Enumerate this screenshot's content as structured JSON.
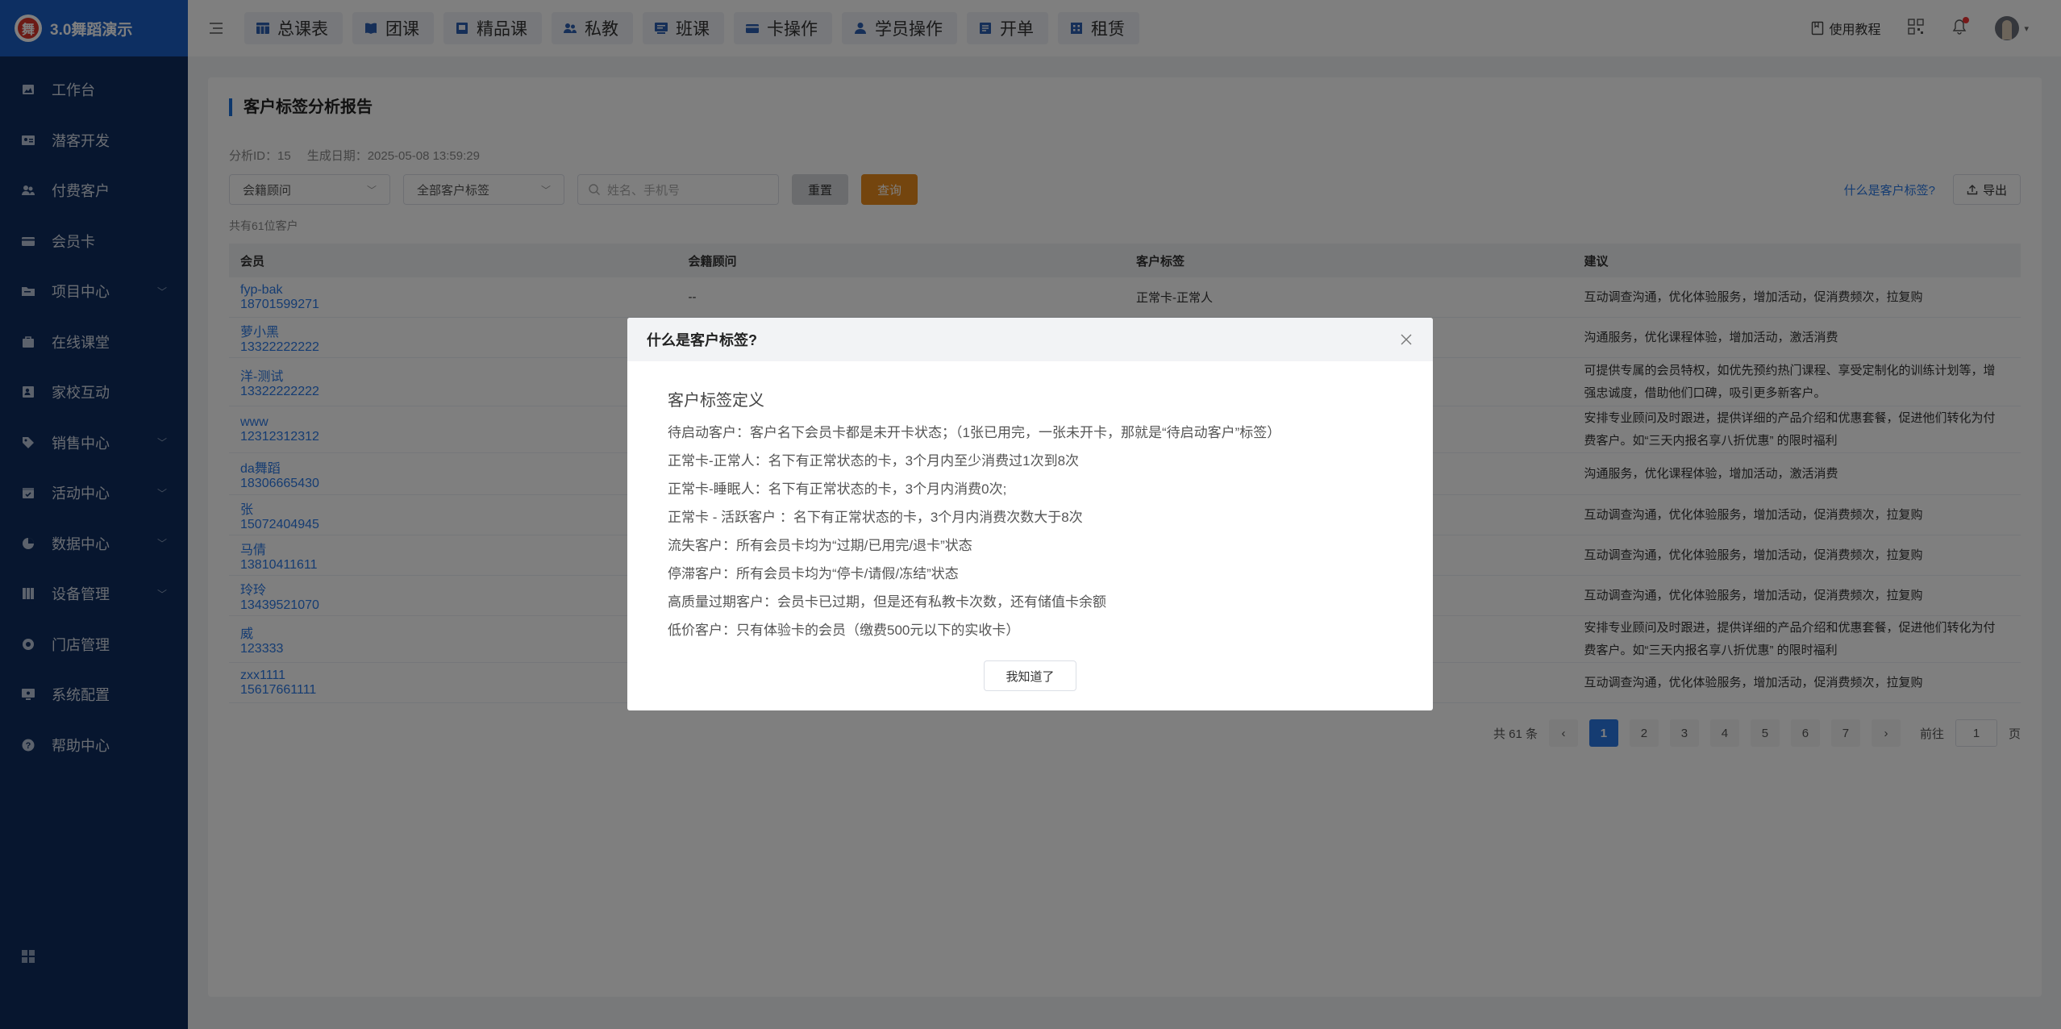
{
  "app": {
    "title": "3.0舞蹈演示",
    "logo_char": "舞"
  },
  "sidebar": {
    "items": [
      {
        "label": "工作台",
        "icon": "image-icon",
        "chevron": false
      },
      {
        "label": "潜客开发",
        "icon": "id-card-icon",
        "chevron": false
      },
      {
        "label": "付费客户",
        "icon": "users-icon",
        "chevron": false
      },
      {
        "label": "会员卡",
        "icon": "card-icon",
        "chevron": false
      },
      {
        "label": "项目中心",
        "icon": "folder-icon",
        "chevron": true
      },
      {
        "label": "在线课堂",
        "icon": "bag-icon",
        "chevron": false
      },
      {
        "label": "家校互动",
        "icon": "contact-icon",
        "chevron": false
      },
      {
        "label": "销售中心",
        "icon": "tag-icon",
        "chevron": true
      },
      {
        "label": "活动中心",
        "icon": "calendar-icon",
        "chevron": true
      },
      {
        "label": "数据中心",
        "icon": "pie-icon",
        "chevron": true
      },
      {
        "label": "设备管理",
        "icon": "device-icon",
        "chevron": true
      },
      {
        "label": "门店管理",
        "icon": "store-icon",
        "chevron": false
      },
      {
        "label": "系统配置",
        "icon": "monitor-icon",
        "chevron": false
      },
      {
        "label": "帮助中心",
        "icon": "help-icon",
        "chevron": false
      }
    ]
  },
  "topnav": {
    "tabs": [
      {
        "label": "总课表",
        "icon": "table-icon"
      },
      {
        "label": "团课",
        "icon": "book-icon"
      },
      {
        "label": "精品课",
        "icon": "premium-icon"
      },
      {
        "label": "私教",
        "icon": "users-icon"
      },
      {
        "label": "班课",
        "icon": "class-icon"
      },
      {
        "label": "卡操作",
        "icon": "card-icon"
      },
      {
        "label": "学员操作",
        "icon": "user-icon"
      },
      {
        "label": "开单",
        "icon": "order-icon"
      },
      {
        "label": "租赁",
        "icon": "building-icon"
      }
    ],
    "tutorial": "使用教程"
  },
  "page": {
    "title": "客户标签分析报告",
    "analysis_id": "分析ID：15",
    "generated": "生成日期：2025-05-08 13:59:29",
    "filter_advisor": "会籍顾问",
    "filter_tags": "全部客户标签",
    "search_placeholder": "姓名、手机号",
    "reset": "重置",
    "query": "查询",
    "what_is_link": "什么是客户标签?",
    "export": "导出",
    "count": "共有61位客户"
  },
  "table": {
    "headers": [
      "会员",
      "会籍顾问",
      "客户标签",
      "建议"
    ],
    "rows": [
      {
        "name": "fyp-bak",
        "phone": "18701599271",
        "advisor": "--",
        "tag": "正常卡-正常人",
        "advice": "互动调查沟通，优化体验服务，增加活动，促消费频次，拉复购",
        "h": 50
      },
      {
        "name": "萝小黑",
        "phone": "13322222222",
        "advisor": "",
        "tag": "",
        "advice": "沟通服务，优化课程体验，增加活动，激活消费",
        "h": 50
      },
      {
        "name": "洋-测试",
        "phone": "13322222222",
        "advisor": "",
        "tag": "",
        "advice": "可提供专属的会员特权，如优先预约热门课程、享受定制化的训练计划等，增强忠诚度，借助他们口碑，吸引更多新客户。",
        "h": 60
      },
      {
        "name": "www",
        "phone": "12312312312",
        "advisor": "",
        "tag": "",
        "advice": "安排专业顾问及时跟进，提供详细的产品介绍和优惠套餐，促进他们转化为付费客户。如“三天内报名享八折优惠” 的限时福利",
        "h": 58
      },
      {
        "name": "da舞蹈",
        "phone": "18306665430",
        "advisor": "",
        "tag": "",
        "advice": "沟通服务，优化课程体验，增加活动，激活消费",
        "h": 52
      },
      {
        "name": "张",
        "phone": "15072404945",
        "advisor": "",
        "tag": "",
        "advice": "互动调查沟通，优化体验服务，增加活动，促消费频次，拉复购",
        "h": 50
      },
      {
        "name": "马倩",
        "phone": "13810411611",
        "advisor": "",
        "tag": "",
        "advice": "互动调查沟通，优化体验服务，增加活动，促消费频次，拉复购",
        "h": 50
      },
      {
        "name": "玲玲",
        "phone": "13439521070",
        "advisor": "",
        "tag": "",
        "advice": "互动调查沟通，优化体验服务，增加活动，促消费频次，拉复购",
        "h": 50
      },
      {
        "name": "威",
        "phone": "123333",
        "advisor": "",
        "tag": "",
        "advice": "安排专业顾问及时跟进，提供详细的产品介绍和优惠套餐，促进他们转化为付费客户。如“三天内报名享八折优惠” 的限时福利",
        "h": 58
      },
      {
        "name": "zxx1111",
        "phone": "15617661111",
        "advisor": "",
        "tag": "",
        "advice": "互动调查沟通，优化体验服务，增加活动，促消费频次，拉复购",
        "h": 50
      }
    ]
  },
  "pagination": {
    "total": "共 61 条",
    "pages": [
      "1",
      "2",
      "3",
      "4",
      "5",
      "6",
      "7"
    ],
    "current": "1",
    "goto_prefix": "前往",
    "goto_value": "1",
    "goto_suffix": "页"
  },
  "modal": {
    "title": "什么是客户标签?",
    "def_title": "客户标签定义",
    "lines": [
      "待启动客户：客户名下会员卡都是未开卡状态；（1张已用完，一张未开卡，那就是“待启动客户”标签）",
      "正常卡-正常人：名下有正常状态的卡，3个月内至少消费过1次到8次",
      "正常卡-睡眠人：名下有正常状态的卡，3个月内消费0次;",
      "正常卡 - 活跃客户 ：名下有正常状态的卡，3个月内消费次数大于8次",
      "流失客户：所有会员卡均为“过期/已用完/退卡”状态",
      "停滞客户：所有会员卡均为“停卡/请假/冻结”状态",
      "高质量过期客户：会员卡已过期，但是还有私教卡次数，还有储值卡余额",
      "低价客户：只有体验卡的会员（缴费500元以下的实收卡）"
    ],
    "ok": "我知道了"
  }
}
